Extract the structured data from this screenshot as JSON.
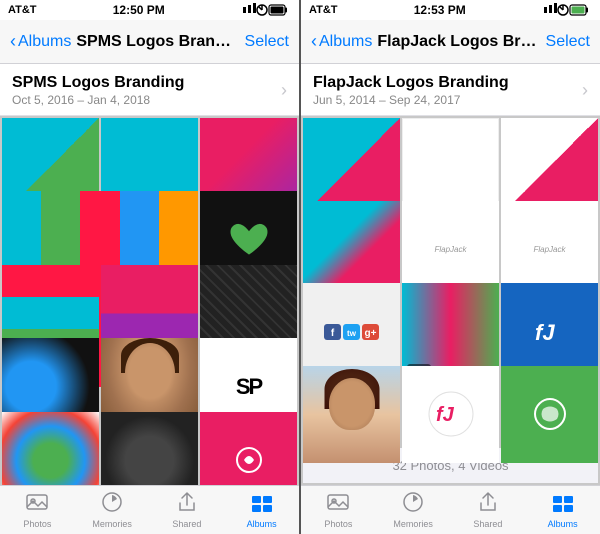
{
  "left_phone": {
    "status": {
      "carrier": "AT&T",
      "time": "12:50 PM",
      "icons": "▶ ✦ ⬛ 100%"
    },
    "nav": {
      "back_label": "Albums",
      "title": "SPMS Logos Branding",
      "select_label": "Select"
    },
    "album": {
      "name": "SPMS Logos Branding",
      "date": "Oct 5, 2016 – Jan 4, 2018"
    },
    "tabs": [
      {
        "label": "Photos",
        "active": false
      },
      {
        "label": "Memories",
        "active": false
      },
      {
        "label": "Shared",
        "active": false
      },
      {
        "label": "Albums",
        "active": true
      }
    ]
  },
  "right_phone": {
    "status": {
      "carrier": "AT&T",
      "time": "12:53 PM",
      "icons": "▶ ✦ ⬛ 100%"
    },
    "nav": {
      "back_label": "Albums",
      "title": "FlapJack Logos Branding",
      "select_label": "Select"
    },
    "album": {
      "name": "FlapJack Logos Branding",
      "date": "Jun 5, 2014 – Sep 24, 2017"
    },
    "photo_count": "32 Photos, 4 Videos",
    "tabs": [
      {
        "label": "Photos",
        "active": false
      },
      {
        "label": "Memories",
        "active": false
      },
      {
        "label": "Shared",
        "active": false
      },
      {
        "label": "Albums",
        "active": true
      }
    ]
  }
}
